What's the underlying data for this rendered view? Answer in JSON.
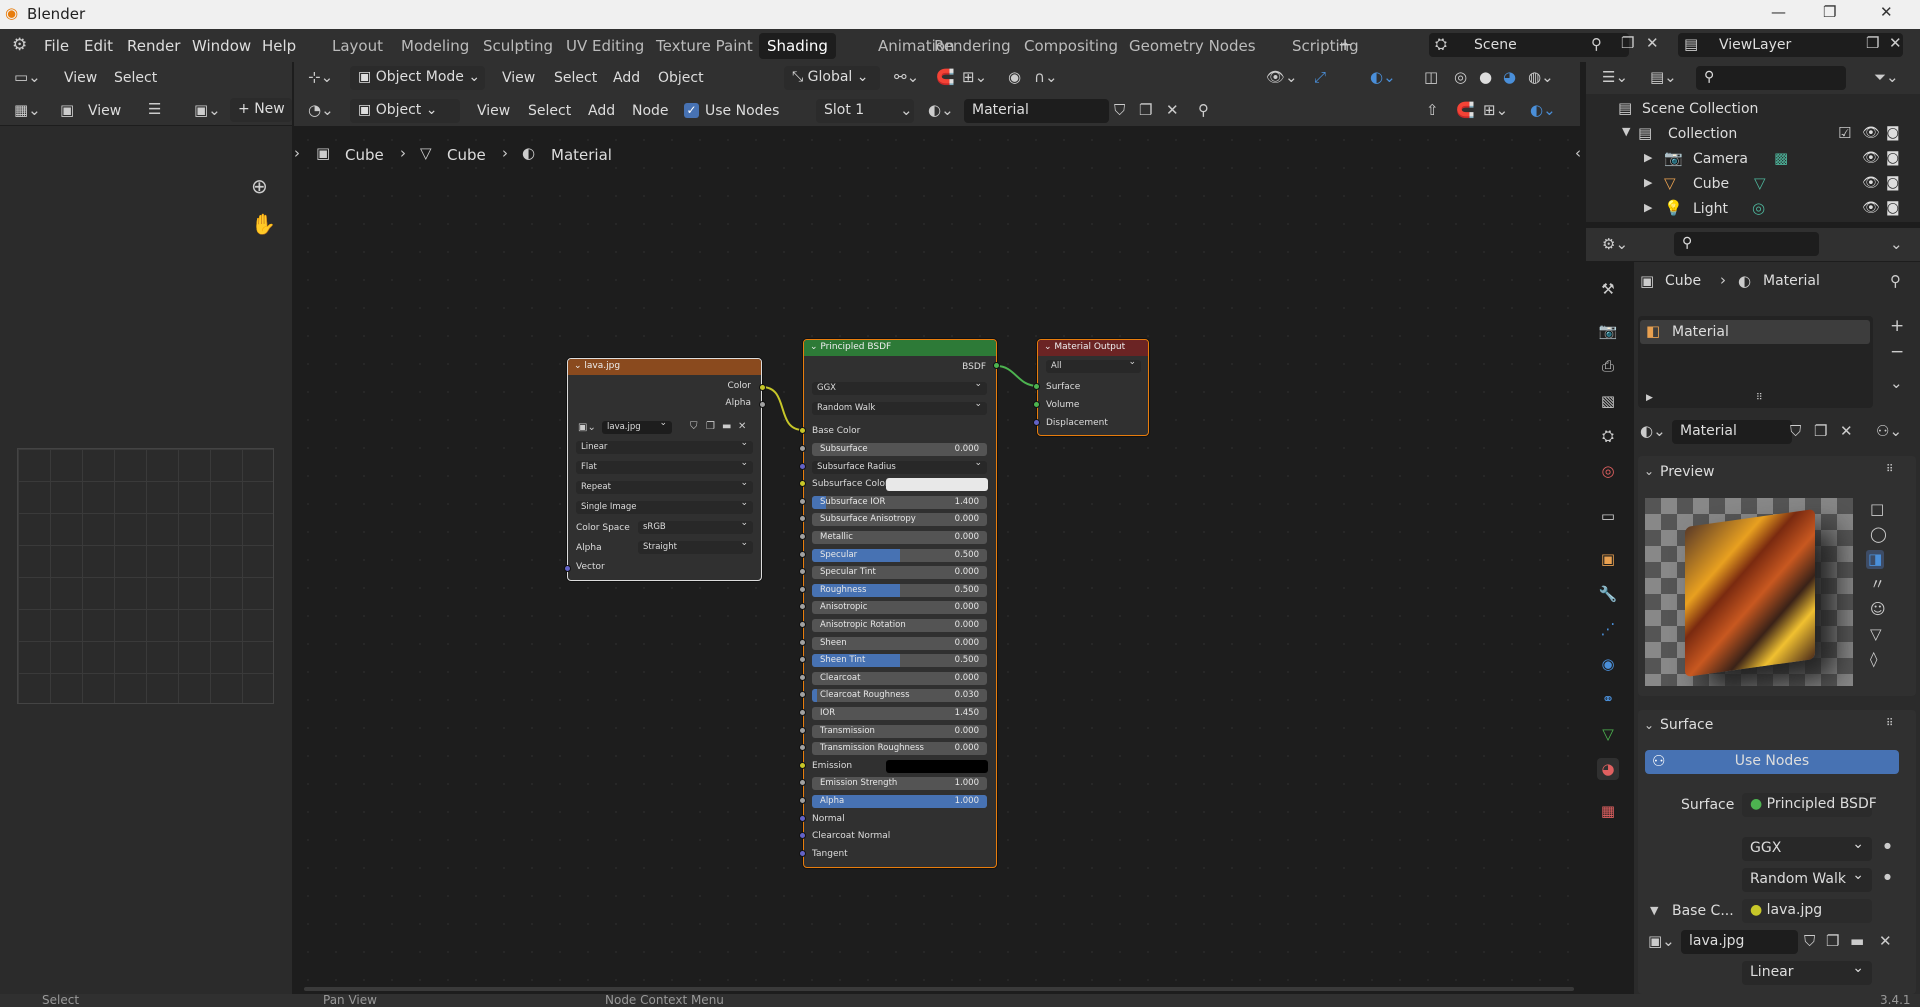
{
  "app": {
    "title": "Blender",
    "win_min": "—",
    "win_max": "❐",
    "win_close": "✕"
  },
  "menu": [
    "File",
    "Edit",
    "Render",
    "Window",
    "Help"
  ],
  "workspaces": [
    "Layout",
    "Modeling",
    "Sculpting",
    "UV Editing",
    "Texture Paint",
    "Shading",
    "Animation",
    "Rendering",
    "Compositing",
    "Geometry Nodes",
    "Scripting"
  ],
  "active_workspace": "Shading",
  "scene": {
    "label": "Scene",
    "viewlayer": "ViewLayer"
  },
  "viewport_header": {
    "mode": "Object Mode",
    "items": [
      "View",
      "Select",
      "Add",
      "Object"
    ],
    "orientation": "Global"
  },
  "left_header": {
    "items": [
      "View",
      "Select"
    ]
  },
  "image_header": {
    "view": "View",
    "new": "New"
  },
  "node_header": {
    "editor": "Object",
    "items": [
      "View",
      "Select",
      "Add",
      "Node"
    ],
    "use_nodes": "Use Nodes",
    "slot": "Slot 1",
    "material": "Material"
  },
  "breadcrumb": [
    "Cube",
    "Cube",
    "Material"
  ],
  "image_node": {
    "title": "lava.jpg",
    "out_color": "Color",
    "out_alpha": "Alpha",
    "image": "lava.jpg",
    "interp": "Linear",
    "proj": "Flat",
    "ext": "Repeat",
    "source": "Single Image",
    "colorspace_label": "Color Space",
    "colorspace": "sRGB",
    "alpha_label": "Alpha",
    "alpha": "Straight",
    "vector": "Vector"
  },
  "bsdf_node": {
    "title": "Principled BSDF",
    "out": "BSDF",
    "dist": "GGX",
    "ss_method": "Random Walk",
    "base_color": "Base Color",
    "fields": [
      {
        "label": "Subsurface",
        "value": "0.000",
        "fill": 0
      },
      {
        "label": "Subsurface Radius",
        "value": "",
        "fill": 0,
        "dropdown": true
      },
      {
        "label": "Subsurface Color",
        "value": "",
        "fill": 0,
        "color": "#e8e8e8"
      },
      {
        "label": "Subsurface IOR",
        "value": "1.400",
        "fill": 0.08
      },
      {
        "label": "Subsurface Anisotropy",
        "value": "0.000",
        "fill": 0
      },
      {
        "label": "Metallic",
        "value": "0.000",
        "fill": 0
      },
      {
        "label": "Specular",
        "value": "0.500",
        "fill": 0.5
      },
      {
        "label": "Specular Tint",
        "value": "0.000",
        "fill": 0
      },
      {
        "label": "Roughness",
        "value": "0.500",
        "fill": 0.5
      },
      {
        "label": "Anisotropic",
        "value": "0.000",
        "fill": 0
      },
      {
        "label": "Anisotropic Rotation",
        "value": "0.000",
        "fill": 0
      },
      {
        "label": "Sheen",
        "value": "0.000",
        "fill": 0
      },
      {
        "label": "Sheen Tint",
        "value": "0.500",
        "fill": 0.5
      },
      {
        "label": "Clearcoat",
        "value": "0.000",
        "fill": 0
      },
      {
        "label": "Clearcoat Roughness",
        "value": "0.030",
        "fill": 0.03
      },
      {
        "label": "IOR",
        "value": "1.450",
        "fill": 0
      },
      {
        "label": "Transmission",
        "value": "0.000",
        "fill": 0
      },
      {
        "label": "Transmission Roughness",
        "value": "0.000",
        "fill": 0
      },
      {
        "label": "Emission",
        "value": "",
        "fill": 0,
        "color": "#000000"
      },
      {
        "label": "Emission Strength",
        "value": "1.000",
        "fill": 0
      },
      {
        "label": "Alpha",
        "value": "1.000",
        "fill": 1
      }
    ],
    "normal": "Normal",
    "clearcoat_normal": "Clearcoat Normal",
    "tangent": "Tangent"
  },
  "output_node": {
    "title": "Material Output",
    "target": "All",
    "surface": "Surface",
    "volume": "Volume",
    "displacement": "Displacement"
  },
  "outliner": {
    "root": "Scene Collection",
    "collection": "Collection",
    "items": [
      "Camera",
      "Cube",
      "Light"
    ]
  },
  "properties": {
    "breadcrumb_obj": "Cube",
    "breadcrumb_mat": "Material",
    "slot": "Material",
    "mat_name": "Material",
    "preview": "Preview",
    "surface_panel": "Surface",
    "use_nodes": "Use Nodes",
    "surface_label": "Surface",
    "surface_value": "Principled BSDF",
    "dist": "GGX",
    "ss": "Random Walk",
    "base_label": "Base C...",
    "base_value": "lava.jpg",
    "image": "lava.jpg",
    "interp": "Linear"
  },
  "status": {
    "select": "Select",
    "pan": "Pan View",
    "ctx": "Node Context Menu",
    "version": "3.4.1"
  }
}
